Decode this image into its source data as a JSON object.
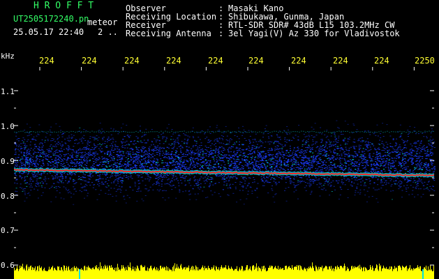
{
  "header": {
    "program": "H R O F F T",
    "filename": "UT2505172240.pn",
    "mode": "meteor",
    "datetime": "25.05.17 22:40",
    "counter": "2 ..",
    "info_labels": [
      "Observer",
      "Receiving Location",
      "Receiver",
      "Receiving Antenna"
    ],
    "info_colons": [
      ":",
      ":",
      ":",
      ":"
    ],
    "info_values": [
      "Masaki Kano",
      "Shibukawa, Gunma, Japan",
      "RTL-SDR SDR# 43dB L15 103.2MHz CW",
      "3el Yagi(V) Az 330 for Vladivostok"
    ]
  },
  "chart_data": {
    "type": "heatmap",
    "ylabel": "kHz",
    "y_ticks": [
      "1.1",
      "1.0",
      "0.9",
      "0.8",
      "0.7",
      "0.6"
    ],
    "x_ticks": [
      "224",
      "224",
      "224",
      "224",
      "224",
      "224",
      "224",
      "224",
      "224",
      "2250"
    ],
    "signal_khz": 0.865,
    "band_khz": [
      0.8,
      0.99
    ],
    "colors": {
      "background": "#000000",
      "noise": "#1a3cff",
      "mid": "#00e0e0",
      "peak": "#ff2020",
      "ticks": "#ffffff",
      "x_labels": "#ffff33",
      "power_trace": "#ffff00"
    }
  }
}
